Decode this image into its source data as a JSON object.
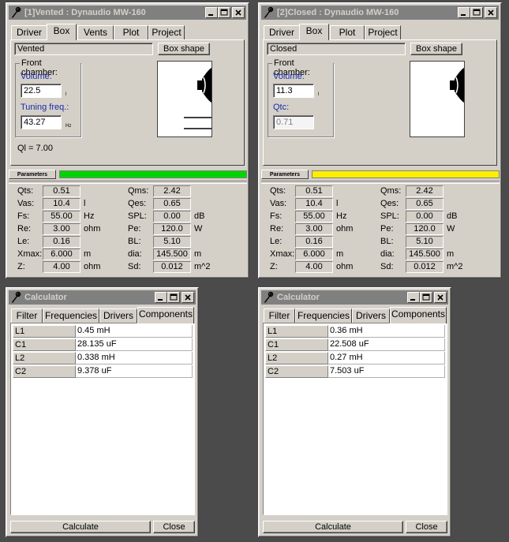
{
  "colors": {
    "title_inactive": "#808080",
    "face": "#d4d0c8",
    "green": "#00d400",
    "yellow": "#ffee00",
    "blue_label": "#1a2aa8"
  },
  "icons": {
    "app": "speaker-wrench-icon",
    "minimize": "minimize-icon",
    "maximize": "maximize-icon",
    "close": "close-icon"
  },
  "win1": {
    "title": "[1]Vented : Dynaudio MW-160",
    "tabs": [
      "Driver",
      "Box",
      "Vents",
      "Plot",
      "Project"
    ],
    "box_type": "Vented",
    "box_shape_label": "Box shape",
    "group_label": "Front chamber:",
    "volume_label": "Volume:",
    "volume_value": "22.5",
    "volume_unit": "l",
    "second_label": "Tuning freq.:",
    "second_value": "43.27",
    "second_unit": "Hz",
    "ql_text": "Ql = 7.00",
    "params_tab": "Parameters",
    "progress": 1.0,
    "params": {
      "qts": "0.51",
      "vas": "10.4",
      "fs": "55.00",
      "re": "3.00",
      "le": "0.16",
      "xmax": "6.000",
      "z": "4.00",
      "qms": "2.42",
      "qes": "0.65",
      "spl": "0.00",
      "pe": "120.0",
      "bl": "5.10",
      "dia": "145.500",
      "sd": "0.012"
    }
  },
  "win2": {
    "title": "[2]Closed : Dynaudio MW-160",
    "tabs": [
      "Driver",
      "Box",
      "Plot",
      "Project"
    ],
    "box_type": "Closed",
    "box_shape_label": "Box shape",
    "group_label": "Front chamber:",
    "volume_label": "Volume:",
    "volume_value": "11.3",
    "volume_unit": "l",
    "second_label": "Qtc:",
    "second_value": "0.71",
    "params_tab": "Parameters",
    "progress": 1.0,
    "params": {
      "qts": "0.51",
      "vas": "10.4",
      "fs": "55.00",
      "re": "3.00",
      "le": "0.16",
      "xmax": "6.000",
      "z": "4.00",
      "qms": "2.42",
      "qes": "0.65",
      "spl": "0.00",
      "pe": "120.0",
      "bl": "5.10",
      "dia": "145.500",
      "sd": "0.012"
    }
  },
  "param_labels": {
    "qts": "Qts:",
    "vas": "Vas:",
    "fs": "Fs:",
    "re": "Re:",
    "le": "Le:",
    "xmax": "Xmax:",
    "z": "Z:",
    "qms": "Qms:",
    "qes": "Qes:",
    "spl": "SPL:",
    "pe": "Pe:",
    "bl": "BL:",
    "dia": "dia:",
    "sd": "Sd:"
  },
  "param_units": {
    "vas": "l",
    "fs": "Hz",
    "re": "ohm",
    "xmax": "m",
    "z": "ohm",
    "spl": "dB",
    "pe": "W",
    "dia": "m",
    "sd": "m^2"
  },
  "calc1": {
    "title": "Calculator",
    "tabs": [
      "Filter",
      "Frequencies",
      "Drivers",
      "Components"
    ],
    "components": [
      {
        "name": "L1",
        "value": "0.45 mH"
      },
      {
        "name": "C1",
        "value": "28.135 uF"
      },
      {
        "name": "L2",
        "value": "0.338 mH"
      },
      {
        "name": "C2",
        "value": "9.378 uF"
      }
    ],
    "calculate_label": "Calculate",
    "close_label": "Close"
  },
  "calc2": {
    "title": "Calculator",
    "tabs": [
      "Filter",
      "Frequencies",
      "Drivers",
      "Components"
    ],
    "components": [
      {
        "name": "L1",
        "value": "0.36 mH"
      },
      {
        "name": "C1",
        "value": "22.508 uF"
      },
      {
        "name": "L2",
        "value": "0.27 mH"
      },
      {
        "name": "C2",
        "value": "7.503 uF"
      }
    ],
    "calculate_label": "Calculate",
    "close_label": "Close"
  }
}
